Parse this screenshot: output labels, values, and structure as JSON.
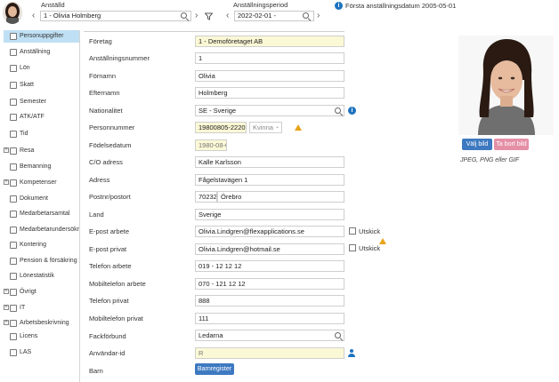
{
  "header": {
    "employee_label": "Anställd",
    "employee_value": "1 - Olivia Holmberg",
    "period_label": "Anställningsperiod",
    "period_value": "2022-02-01 -",
    "first_employment": "Första anställningsdatum 2005-05-01"
  },
  "sidebar": {
    "items": [
      {
        "label": "Personuppgifter",
        "expandable": false,
        "active": true
      },
      {
        "label": "Anställning",
        "expandable": false,
        "active": false
      },
      {
        "label": "Lön",
        "expandable": false,
        "active": false
      },
      {
        "label": "Skatt",
        "expandable": false,
        "active": false
      },
      {
        "label": "Semester",
        "expandable": false,
        "active": false
      },
      {
        "label": "ATK/ATF",
        "expandable": false,
        "active": false
      },
      {
        "label": "Tid",
        "expandable": false,
        "active": false
      },
      {
        "label": "Resa",
        "expandable": true,
        "active": false
      },
      {
        "label": "Bemanning",
        "expandable": false,
        "active": false
      },
      {
        "label": "Kompetenser",
        "expandable": true,
        "active": false
      },
      {
        "label": "Dokument",
        "expandable": false,
        "active": false
      },
      {
        "label": "Medarbetarsamtal",
        "expandable": false,
        "active": false
      },
      {
        "label": "Medarbetarundersökning",
        "expandable": false,
        "active": false
      },
      {
        "label": "Kontering",
        "expandable": false,
        "active": false
      },
      {
        "label": "Pension & försäkring",
        "expandable": false,
        "active": false
      },
      {
        "label": "Lönestatistik",
        "expandable": false,
        "active": false
      },
      {
        "label": "Övrigt",
        "expandable": true,
        "active": false
      },
      {
        "label": "IT",
        "expandable": true,
        "active": false
      },
      {
        "label": "Arbetsbeskrivning",
        "expandable": true,
        "active": false
      },
      {
        "label": "Licens",
        "expandable": false,
        "active": false
      },
      {
        "label": "LAS",
        "expandable": false,
        "active": false
      }
    ]
  },
  "form": {
    "foretag": {
      "label": "Företag",
      "value": "1 - Demoföretaget AB"
    },
    "anstallningsnummer": {
      "label": "Anställningsnummer",
      "value": "1"
    },
    "fornamn": {
      "label": "Förnamn",
      "value": "Olivia"
    },
    "efternamn": {
      "label": "Efternamn",
      "value": "Holmberg"
    },
    "nationalitet": {
      "label": "Nationalitet",
      "value": "SE - Sverige"
    },
    "personnummer": {
      "label": "Personnummer",
      "value": "19800805-2220",
      "gender": "Kvinna"
    },
    "fodelsedatum": {
      "label": "Födelsedatum",
      "value": "1980-08-05"
    },
    "co_adress": {
      "label": "C/O adress",
      "value": "Kalle Karlsson"
    },
    "adress": {
      "label": "Adress",
      "value": "Fågelstavägen 1"
    },
    "postnr": {
      "label": "Postnr/postort",
      "postnr": "70232",
      "postort": "Örebro"
    },
    "land": {
      "label": "Land",
      "value": "Sverige"
    },
    "epost_arbete": {
      "label": "E-post arbete",
      "value": "Olivia.Lindgren@flexapplications.se",
      "utskick": "Utskick"
    },
    "epost_privat": {
      "label": "E-post privat",
      "value": "Olivia.Lindgren@hotmail.se",
      "utskick": "Utskick"
    },
    "telefon_arbete": {
      "label": "Telefon arbete",
      "value": "019 - 12 12 12"
    },
    "mobil_arbete": {
      "label": "Mobiltelefon arbete",
      "value": "070 - 121 12 12"
    },
    "telefon_privat": {
      "label": "Telefon privat",
      "value": "888"
    },
    "mobil_privat": {
      "label": "Mobiltelefon privat",
      "value": "111"
    },
    "fackforbund": {
      "label": "Fackförbund",
      "value": "Ledarna"
    },
    "anvandar_id": {
      "label": "Användar-id",
      "value": "R"
    },
    "barn": {
      "label": "Barn",
      "button": "Barnregister"
    }
  },
  "photo": {
    "choose_button": "Välj bild",
    "remove_button": "Ta bort bild",
    "hint": "JPEG, PNG eller GIF"
  },
  "colors": {
    "active_nav": "#bfe0f4",
    "accent_blue": "#3d79c0",
    "remove_pink": "#e58fa6",
    "required_yellow": "#fbf8d6",
    "info_blue": "#1e73be",
    "warning": "#e8a317"
  },
  "icons": {
    "search": "search-icon",
    "filter": "filter-icon",
    "info": "info-icon",
    "warning": "warning-icon",
    "user": "user-icon"
  }
}
